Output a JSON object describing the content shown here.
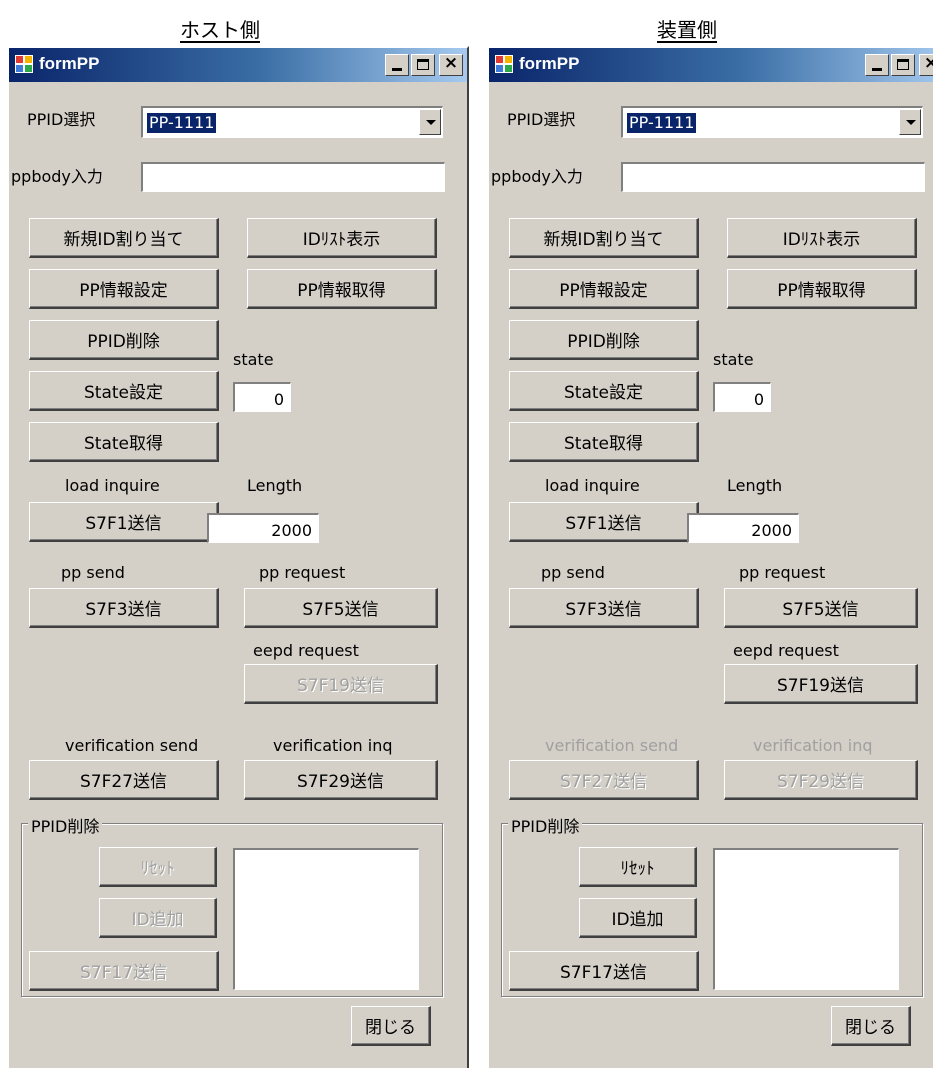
{
  "captions": {
    "left": "ホスト側",
    "right": "装置側"
  },
  "windows": [
    {
      "title": "formPP",
      "ppid_label": "PPID選択",
      "ppid_value": "PP-1111",
      "ppbody_label": "ppbody入力",
      "ppbody_value": "",
      "buttons": {
        "new_id": "新規ID割り当て",
        "id_list": "IDﾘｽﾄ表示",
        "pp_info_set": "PP情報設定",
        "pp_info_get": "PP情報取得",
        "ppid_delete": "PPID削除",
        "state_set": "State設定",
        "state_get": "State取得",
        "s7f1": "S7F1送信",
        "s7f3": "S7F3送信",
        "s7f5": "S7F5送信",
        "s7f19": "S7F19送信",
        "s7f27": "S7F27送信",
        "s7f29": "S7F29送信",
        "reset": "ﾘｾｯﾄ",
        "id_add": "ID追加",
        "s7f17": "S7F17送信",
        "close": "閉じる"
      },
      "labels": {
        "state": "state",
        "load_inquire": "load inquire",
        "length": "Length",
        "pp_send": "pp send",
        "pp_request": "pp request",
        "eepd_request": "eepd request",
        "verification_send": "verification send",
        "verification_inq": "verification inq"
      },
      "state_value": "0",
      "length_value": "2000",
      "group_title": "PPID削除",
      "enabled": {
        "s7f19": false,
        "verification": true,
        "group": false
      }
    },
    {
      "title": "formPP",
      "ppid_label": "PPID選択",
      "ppid_value": "PP-1111",
      "ppbody_label": "ppbody入力",
      "ppbody_value": "",
      "buttons": {
        "new_id": "新規ID割り当て",
        "id_list": "IDﾘｽﾄ表示",
        "pp_info_set": "PP情報設定",
        "pp_info_get": "PP情報取得",
        "ppid_delete": "PPID削除",
        "state_set": "State設定",
        "state_get": "State取得",
        "s7f1": "S7F1送信",
        "s7f3": "S7F3送信",
        "s7f5": "S7F5送信",
        "s7f19": "S7F19送信",
        "s7f27": "S7F27送信",
        "s7f29": "S7F29送信",
        "reset": "ﾘｾｯﾄ",
        "id_add": "ID追加",
        "s7f17": "S7F17送信",
        "close": "閉じる"
      },
      "labels": {
        "state": "state",
        "load_inquire": "load inquire",
        "length": "Length",
        "pp_send": "pp send",
        "pp_request": "pp request",
        "eepd_request": "eepd request",
        "verification_send": "verification send",
        "verification_inq": "verification inq"
      },
      "state_value": "0",
      "length_value": "2000",
      "group_title": "PPID削除",
      "enabled": {
        "s7f19": true,
        "verification": false,
        "group": true
      }
    }
  ],
  "colors": {
    "face": "#d4d0c8",
    "title_start": "#0a246a",
    "title_end": "#a6caf0",
    "disabled_text": "#a0a0a0"
  },
  "icons": {
    "app": "form-app-icon",
    "minimize": "minimize-icon",
    "maximize": "maximize-icon",
    "close": "close-icon",
    "dropdown": "chevron-down-icon"
  }
}
